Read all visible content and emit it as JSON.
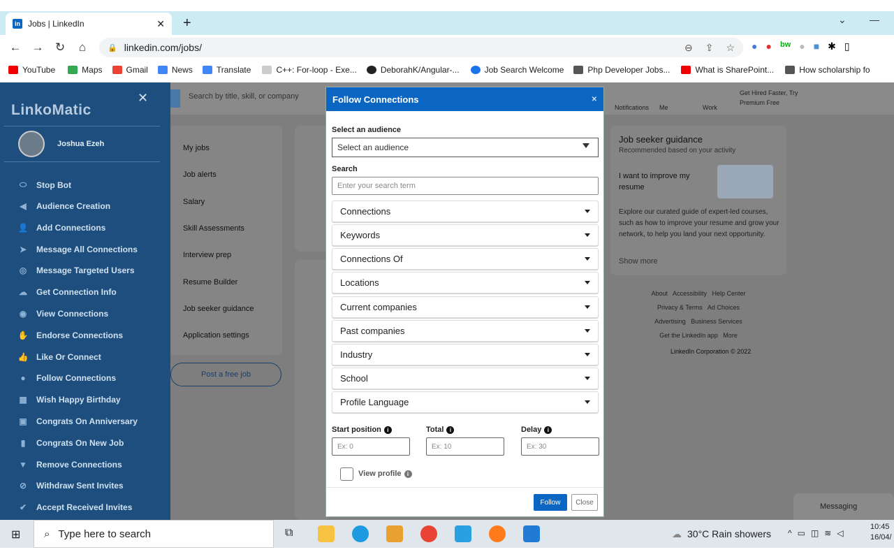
{
  "browser": {
    "tab_title": "Jobs | LinkedIn",
    "url": "linkedin.com/jobs/",
    "bookmarks": [
      "YouTube",
      "Maps",
      "Gmail",
      "News",
      "Translate",
      "C++: For-loop - Exe...",
      "DeborahK/Angular-...",
      "Job Search Welcome",
      "Php Developer Jobs...",
      "What is SharePoint...",
      "How scholarship fo"
    ]
  },
  "linkedin": {
    "search_placeholder": "Search by title, skill, or company",
    "nav": [
      "Notifications",
      "Me",
      "Work"
    ],
    "premium": "Get Hired Faster, Try Premium Free",
    "left_menu": [
      "My jobs",
      "Job alerts",
      "Salary",
      "Skill Assessments",
      "Interview prep",
      "Resume Builder",
      "Job seeker guidance",
      "Application settings"
    ],
    "post_job": "Post a free job",
    "guidance_title": "Job seeker guidance",
    "guidance_sub": "Recommended based on your activity",
    "guidance_card": "I want to improve my resume",
    "guidance_text": "Explore our curated guide of expert-led courses, such as how to improve your resume and grow your network, to help you land your next opportunity.",
    "show_more": "Show more",
    "footer": [
      "About",
      "Accessibility",
      "Help Center",
      "Privacy & Terms",
      "Ad Choices",
      "Advertising",
      "Business Services",
      "Get the LinkedIn app",
      "More"
    ],
    "copyright": "LinkedIn Corporation © 2022",
    "messaging": "Messaging"
  },
  "sidebar": {
    "brand": "LinkoMatic",
    "user": "Joshua Ezeh",
    "items": [
      "Stop Bot",
      "Audience Creation",
      "Add Connections",
      "Message All Connections",
      "Message Targeted Users",
      "Get Connection Info",
      "View Connections",
      "Endorse Connections",
      "Like Or Connect",
      "Follow Connections",
      "Wish Happy Birthday",
      "Congrats On Anniversary",
      "Congrats On New Job",
      "Remove Connections",
      "Withdraw Sent Invites",
      "Accept Received Invites"
    ]
  },
  "modal": {
    "title": "Follow Connections",
    "audience_label": "Select an audience",
    "audience_value": "Select an audience",
    "search_label": "Search",
    "search_placeholder": "Enter your search term",
    "filters": [
      "Connections",
      "Keywords",
      "Connections Of",
      "Locations",
      "Current companies",
      "Past companies",
      "Industry",
      "School",
      "Profile Language"
    ],
    "start_label": "Start position",
    "start_ph": "Ex: 0",
    "total_label": "Total",
    "total_ph": "Ex: 10",
    "delay_label": "Delay",
    "delay_ph": "Ex: 30",
    "view_profile": "View profile",
    "follow": "Follow",
    "close": "Close"
  },
  "taskbar": {
    "search": "Type here to search",
    "weather": "30°C  Rain showers",
    "time": "10:45",
    "date": "16/04/"
  }
}
